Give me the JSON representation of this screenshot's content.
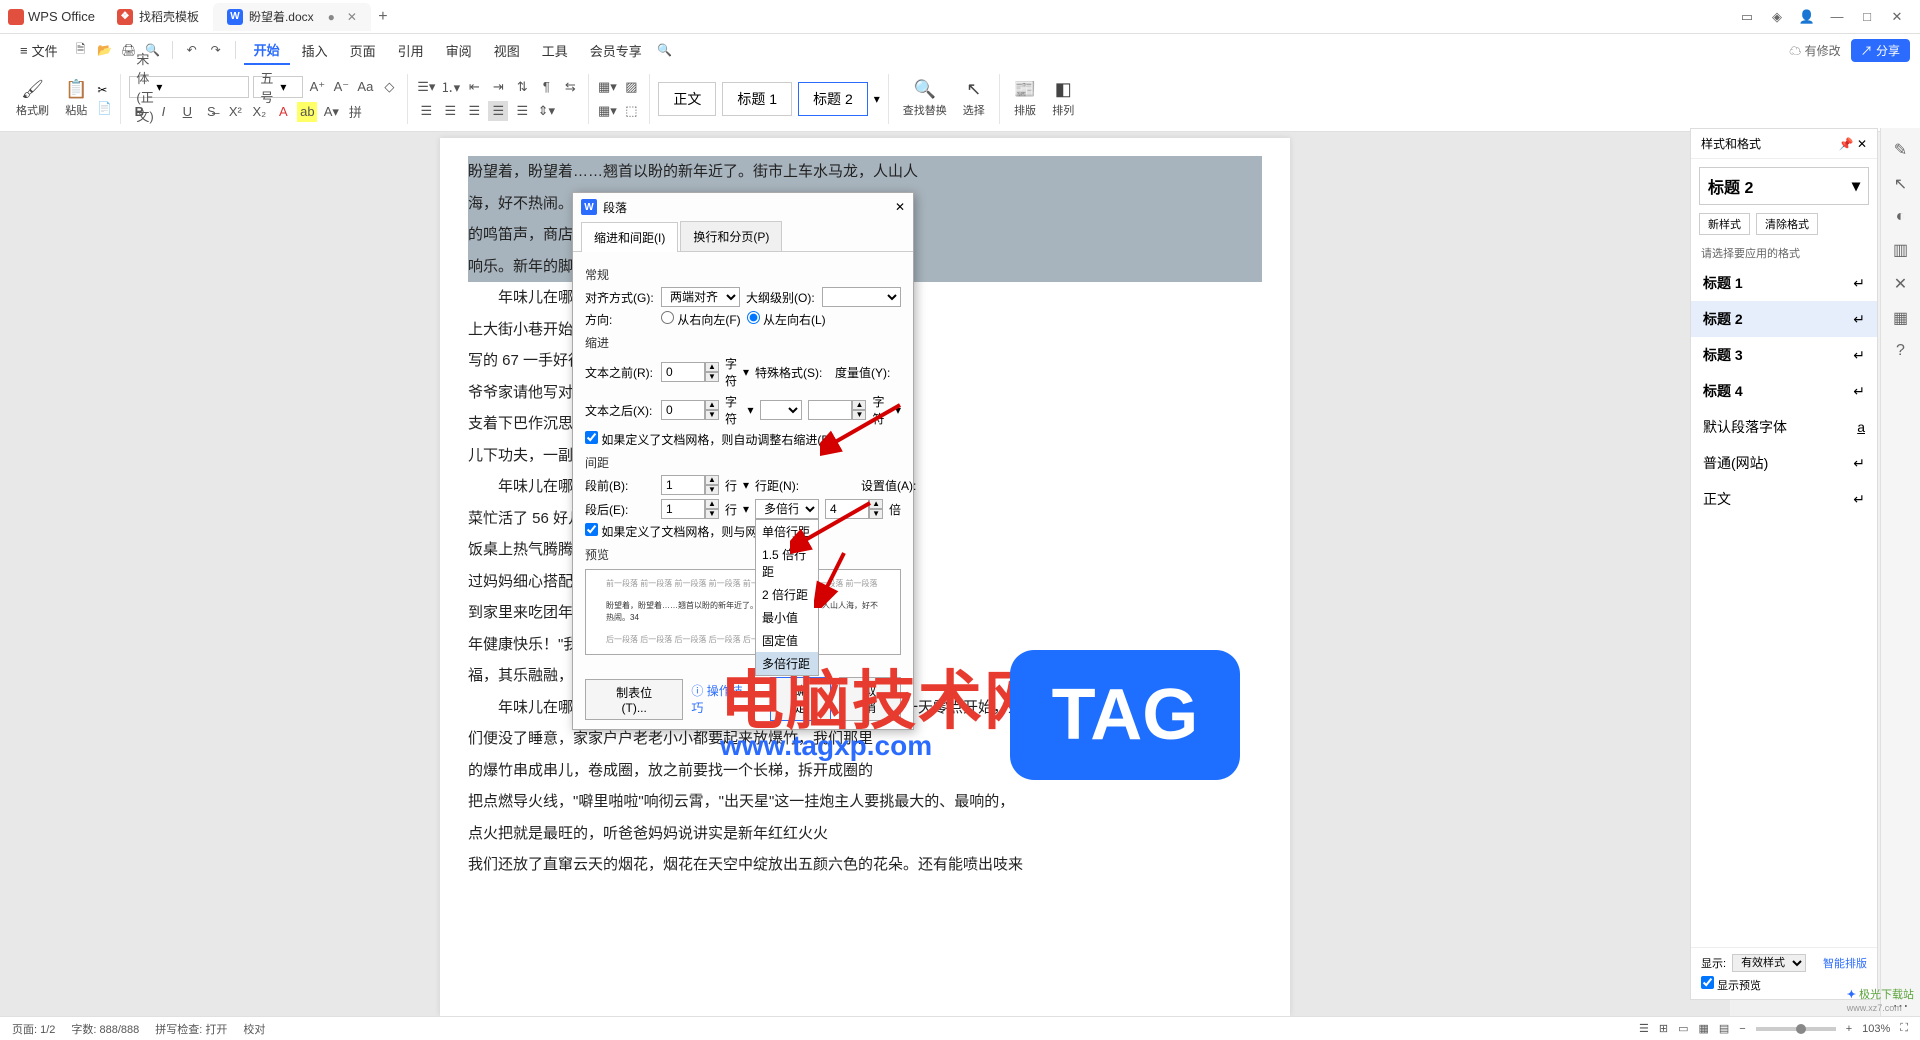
{
  "titlebar": {
    "app": "WPS Office",
    "tabs": [
      {
        "icon_bg": "#e14f3e",
        "icon": "✕",
        "label": "找稻壳模板"
      },
      {
        "icon_bg": "#2b6cff",
        "icon": "W",
        "label": "盼望着.docx",
        "active": true,
        "dirty": "●"
      }
    ],
    "win_icons": [
      "▭",
      "◇",
      "👤",
      "—",
      "□",
      "✕"
    ]
  },
  "menubar": {
    "file": "文件",
    "quick_icons": [
      "🗎",
      "🖶",
      "🖨",
      "⟳",
      "↶",
      "↷"
    ],
    "items": [
      "开始",
      "插入",
      "页面",
      "引用",
      "审阅",
      "视图",
      "工具",
      "会员专享"
    ],
    "active": "开始",
    "search_icon": "🔍",
    "modify": "有修改",
    "share": "分享"
  },
  "ribbon": {
    "format_brush": "格式刷",
    "paste": "粘贴",
    "cut_icon": "✂",
    "copy_icon": "📋",
    "font_name": "宋体 (正文)",
    "font_size": "五号",
    "styles": {
      "normal": "正文",
      "h1": "标题 1",
      "h2": "标题 2"
    },
    "find": "查找替换",
    "select": "选择",
    "layout": "排版",
    "arrange": "排列"
  },
  "doc": {
    "p1": "盼望着，盼望着……翘首以盼的新年近了。街市上车水马龙，人山人",
    "p2": "海，好不热闹。34 瞧，拎着大大小小行李箱的人在街上行走，汽车",
    "p3": "的鸣笛声，商店的叫卖声，",
    "p4": "响乐。新年的脚步近了，",
    "p5": "　　年味儿在哪里？哦，年味儿",
    "p6": "上大街小巷开始卖起了大红的长线",
    "p7": "写的 67 一手好行书字，所以一到",
    "p8": "爷爷家请他写对联，爷爷也乐意",
    "p9": "支着下巴作沉思状，然后，一手提",
    "p10": "儿下功夫，一副对联就大功告",
    "p11": "　　年味儿在哪里？哦，年味儿",
    "p12": "菜忙活了 56 好几天。除夕那天，",
    "p13": "饭桌上热气腾腾，香气扑鼻 08 而",
    "p14": "过妈妈细心搭配，让人看了就有食",
    "p15": "到家里来吃团年饭，\"表叔，我那",
    "p16": "年健康快乐！\"我喝饮料轮流敬",
    "p17": "福，其乐融融，好不热闹。",
    "p18": "　　年味儿在哪里？哦，年味儿在那震耳欲聋的爆竹声中。新年第一天零点开始，人",
    "p19": "们便没了睡意，家家户户老老小小都要起来放爆竹，我们那里",
    "p20": "的爆竹串成串儿，卷成圈，放之前要找一个长梯，拆开成圈的",
    "p21": "把点燃导火线，\"噼里啪啦\"响彻云霄，\"出天星\"这一挂炮主人要挑最大的、最响的，",
    "p22": "点火把就是最旺的，听爸爸妈妈说讲实是新年红红火火",
    "p23": "我们还放了直窜云天的烟花，烟花在天空中绽放出五颜六色的花朵。还有能喷出吱来"
  },
  "dialog": {
    "title": "段落",
    "tab1": "缩进和间距(I)",
    "tab2": "换行和分页(P)",
    "sec_general": "常规",
    "align_label": "对齐方式(G):",
    "align_val": "两端对齐",
    "outline_label": "大纲级别(O):",
    "outline_val": "",
    "dir_label": "方向:",
    "dir_rtl": "从右向左(F)",
    "dir_ltr": "从左向右(L)",
    "sec_indent": "缩进",
    "before_text": "文本之前(R):",
    "after_text": "文本之后(X):",
    "char_unit": "字符",
    "char_unit2": "字符",
    "special": "特殊格式(S):",
    "metric": "度量值(Y):",
    "auto_indent": "如果定义了文档网格，则自动调整右缩进(D)",
    "sec_spacing": "间距",
    "before_para": "段前(B):",
    "after_para": "段后(E):",
    "line_unit": "行",
    "line_label": "行距(N):",
    "setval": "设置值(A):",
    "line_spacing_val": "多倍行距",
    "setval_num": "4",
    "multiple_unit": "倍",
    "dd_opts": [
      "单倍行距",
      "1.5 倍行距",
      "2 倍行距",
      "最小值",
      "固定值",
      "多倍行距"
    ],
    "auto_grid": "如果定义了文档网格，则与网格对",
    "preview": "预览",
    "preview_text": "盼望着，盼望着……翘首以盼的新年近了。街市上车水马龙，人山人海，好不热闹。34",
    "tabstop": "制表位(T)...",
    "tips": "操作技巧",
    "ok": "确定",
    "cancel": "取消",
    "zero": "0",
    "one": "1"
  },
  "stylepane": {
    "title": "样式和格式",
    "current": "标题 2",
    "new_style": "新样式",
    "clear": "清除格式",
    "hint": "请选择要应用的格式",
    "items": [
      "标题 1",
      "标题 2",
      "标题 3",
      "标题 4",
      "默认段落字体",
      "普通(网站)",
      "正文"
    ],
    "selected": "标题 2",
    "show": "显示:",
    "show_val": "有效样式",
    "preview": "显示预览"
  },
  "status": {
    "page": "页面: 1/2",
    "words": "字数: 888/888",
    "spell": "拼写检查: 打开",
    "proof": "校对",
    "zoom": "103%",
    "smart": "智能排版"
  },
  "watermark": {
    "txt": "电脑技术网",
    "url": "www.tagxp.com",
    "tag": "TAG",
    "corner": "极光下载站"
  }
}
